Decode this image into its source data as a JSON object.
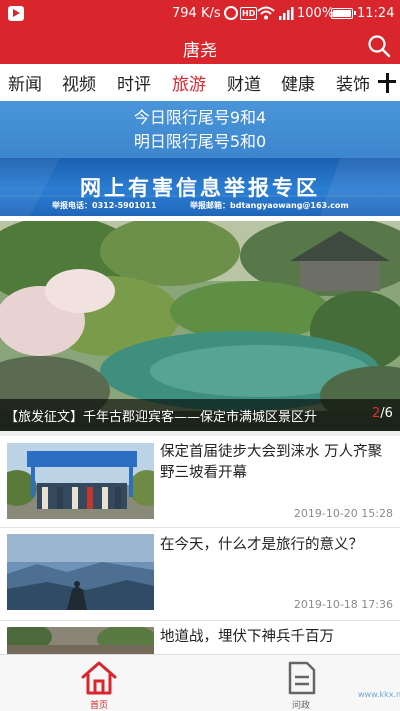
{
  "status_bar": {
    "speed": "794 K/s",
    "hd": "HD",
    "battery": "100%",
    "time": "11:24"
  },
  "header": {
    "title": "唐尧"
  },
  "tabs": [
    {
      "label": "新闻",
      "active": false
    },
    {
      "label": "视频",
      "active": false
    },
    {
      "label": "时评",
      "active": false
    },
    {
      "label": "旅游",
      "active": true
    },
    {
      "label": "财道",
      "active": false
    },
    {
      "label": "健康",
      "active": false
    },
    {
      "label": "装饰",
      "active": false
    }
  ],
  "traffic_notice": {
    "today": "今日限行尾号9和4",
    "tomorrow": "明日限行尾号5和0"
  },
  "report_banner": {
    "title": "网上有害信息举报专区",
    "phone": "举报电话：0312-5901011",
    "email": "举报邮箱：bdtangyaowang@163.com"
  },
  "carousel": {
    "caption": "【旅发征文】千年古郡迎宾客——保定市满城区景区升",
    "current": "2",
    "total": "/6"
  },
  "news": [
    {
      "title": "保定首届徒步大会到涞水 万人齐聚野三坡看开幕",
      "date": "2019-10-20 15:28"
    },
    {
      "title": "在今天，什么才是旅行的意义？",
      "date": "2019-10-18 17:36"
    },
    {
      "title": "地道战，埋伏下神兵千百万",
      "date": ""
    }
  ],
  "bottom_nav": [
    {
      "label": "首页",
      "icon": "home-icon",
      "active": true
    },
    {
      "label": "问政",
      "icon": "document-icon",
      "active": false
    }
  ],
  "watermark": "www.kkx.net",
  "colors": {
    "brand_red": "#d9262c",
    "traffic_blue": "#4a95d9",
    "report_blue": "#1f66ba"
  }
}
